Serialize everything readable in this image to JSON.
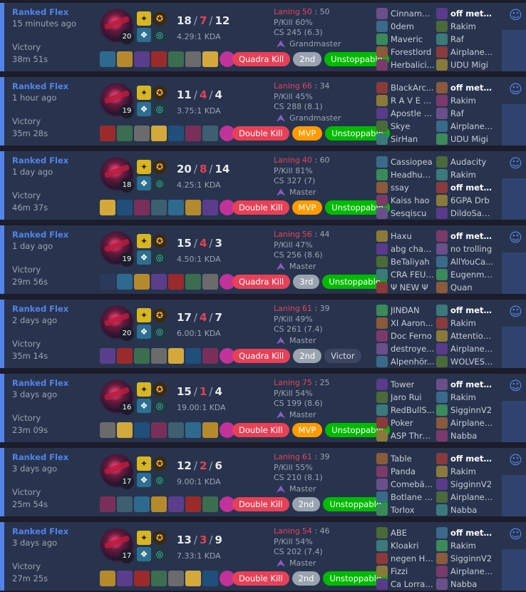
{
  "colors": {
    "accent": "#5383e8",
    "loss": "#e84057",
    "mvp": "#ff9b00",
    "green": "#00bb00"
  },
  "icons": {
    "champion": "champion-portrait",
    "spell1": "flash-icon",
    "spell2": "ghost-icon",
    "rune": "keystone-rune-icon",
    "detail": "ai-score-icon",
    "expand": "chevron-down-icon"
  },
  "matches": [
    {
      "queue": "Ranked Flex",
      "ago": "15 minutes ago",
      "result": "Victory",
      "length": "38m 51s",
      "level": "20",
      "kills": "18",
      "deaths": "7",
      "assists": "12",
      "ratio": "4.29:1 KDA",
      "laning_label": "Laning",
      "laning": "50",
      "laning_opp": "50",
      "pkill": "P/Kill 60%",
      "cs": "CS 245 (6.3)",
      "rank": "Grandmaster",
      "tags": [
        {
          "text": "Quadra Kill",
          "tone": "red"
        },
        {
          "text": "2nd",
          "tone": "grey"
        },
        {
          "text": "Unstoppable",
          "tone": "green"
        }
      ],
      "team1": [
        "Cinnamor...",
        "0dem",
        "Maveric",
        "Forestlord",
        "Herbalici..."
      ],
      "team2": [
        "off meta ...",
        "Rakim",
        "Raf",
        "Airplane ...",
        "UDU Migi"
      ],
      "team2_me": 0
    },
    {
      "queue": "Ranked Flex",
      "ago": "1 hour ago",
      "result": "Victory",
      "length": "35m 28s",
      "level": "19",
      "kills": "11",
      "deaths": "4",
      "assists": "4",
      "ratio": "3.75:1 KDA",
      "laning_label": "Laning",
      "laning": "66",
      "laning_opp": "34",
      "pkill": "P/Kill 45%",
      "cs": "CS 288 (8.1)",
      "rank": "Grandmaster",
      "tags": [
        {
          "text": "Double Kill",
          "tone": "red"
        },
        {
          "text": "MVP",
          "tone": "gold"
        },
        {
          "text": "Unstoppable",
          "tone": "green"
        }
      ],
      "team1": [
        "BlackArc...",
        "R A V E L ...",
        "Apostle o...",
        "Skye",
        "SirHan"
      ],
      "team2": [
        "off meta ...",
        "Rakim",
        "Raf",
        "Airplane ...",
        "UDU Migi"
      ],
      "team2_me": 0
    },
    {
      "queue": "Ranked Flex",
      "ago": "1 day ago",
      "result": "Victory",
      "length": "46m 37s",
      "level": "18",
      "kills": "20",
      "deaths": "8",
      "assists": "14",
      "ratio": "4.25:1 KDA",
      "laning_label": "Laning",
      "laning": "40",
      "laning_opp": "60",
      "pkill": "P/Kill 81%",
      "cs": "CS 327 (7)",
      "rank": "Master",
      "tags": [
        {
          "text": "Double Kill",
          "tone": "red"
        },
        {
          "text": "MVP",
          "tone": "gold"
        },
        {
          "text": "Unstoppable",
          "tone": "green"
        }
      ],
      "team1": [
        "Cassiopea",
        "Headhun...",
        "ssay",
        "Kaiss hao",
        "Sesqiscu"
      ],
      "team2": [
        "Audacity",
        "Rakim",
        "off meta ...",
        "6GPA Drb",
        "DildoSau..."
      ],
      "team2_me": 2
    },
    {
      "queue": "Ranked Flex",
      "ago": "1 day ago",
      "result": "Victory",
      "length": "29m 56s",
      "level": "19",
      "kills": "15",
      "deaths": "4",
      "assists": "3",
      "ratio": "4.50:1 KDA",
      "laning_label": "Laning",
      "laning": "56",
      "laning_opp": "44",
      "pkill": "P/Kill 47%",
      "cs": "CS 256 (8.6)",
      "rank": "Master",
      "tags": [
        {
          "text": "Quadra Kill",
          "tone": "red"
        },
        {
          "text": "3rd",
          "tone": "grey"
        },
        {
          "text": "Unstoppable",
          "tone": "green"
        }
      ],
      "team1": [
        "Haxu",
        "abg chaser",
        "BeTaliyah",
        "CRA FEU ...",
        "Ψ NEW Ψ"
      ],
      "team2": [
        "off meta ...",
        "no trolling",
        "AllYouCa...",
        "Eugenms...",
        "Quan"
      ],
      "team2_me": 0
    },
    {
      "queue": "Ranked Flex",
      "ago": "2 days ago",
      "result": "Victory",
      "length": "35m 14s",
      "level": "20",
      "kills": "17",
      "deaths": "4",
      "assists": "7",
      "ratio": "6.00:1 KDA",
      "laning_label": "Laning",
      "laning": "61",
      "laning_opp": "39",
      "pkill": "P/Kill 49%",
      "cs": "CS 261 (7.4)",
      "rank": "Master",
      "tags": [
        {
          "text": "Quadra Kill",
          "tone": "red"
        },
        {
          "text": "2nd",
          "tone": "grey"
        },
        {
          "text": "Victor",
          "tone": "dark"
        }
      ],
      "team1": [
        "JINĐAN",
        "XI Aaron...",
        "Doc Ferno",
        "destroye...",
        "Alpenhör..."
      ],
      "team2": [
        "off meta ...",
        "Rakim",
        "Attention...",
        "Airplane ...",
        "WOLVES ..."
      ],
      "team2_me": 0
    },
    {
      "queue": "Ranked Flex",
      "ago": "3 days ago",
      "result": "Victory",
      "length": "23m 09s",
      "level": "16",
      "kills": "15",
      "deaths": "1",
      "assists": "4",
      "ratio": "19.00:1 KDA",
      "laning_label": "Laning",
      "laning": "75",
      "laning_opp": "25",
      "pkill": "P/Kill 54%",
      "cs": "CS 199 (8.6)",
      "rank": "Master",
      "tags": [
        {
          "text": "Double Kill",
          "tone": "red"
        },
        {
          "text": "MVP",
          "tone": "gold"
        },
        {
          "text": "Unstoppable",
          "tone": "green"
        }
      ],
      "team1": [
        "Tower",
        "Jaro Rui",
        "RedBullS...",
        "Poker",
        "ASP Thre..."
      ],
      "team2": [
        "off meta ...",
        "Rakim",
        "SigginnV2",
        "Airplane ...",
        "Nabba"
      ],
      "team2_me": 0
    },
    {
      "queue": "Ranked Flex",
      "ago": "3 days ago",
      "result": "Victory",
      "length": "25m 54s",
      "level": "17",
      "kills": "12",
      "deaths": "2",
      "assists": "6",
      "ratio": "9.00:1 KDA",
      "laning_label": "Laning",
      "laning": "61",
      "laning_opp": "39",
      "pkill": "P/Kill 55%",
      "cs": "CS 210 (8.1)",
      "rank": "Master",
      "tags": [
        {
          "text": "Double Kill",
          "tone": "red"
        },
        {
          "text": "2nd",
          "tone": "grey"
        },
        {
          "text": "Unstoppable",
          "tone": "green"
        }
      ],
      "team1": [
        "Table",
        "Panda",
        "Comebäc...",
        "Botlane R...",
        "Torlox"
      ],
      "team2": [
        "off meta ...",
        "Rakim",
        "SigginnV2",
        "Airplane ...",
        "Nabba"
      ],
      "team2_me": 0
    },
    {
      "queue": "Ranked Flex",
      "ago": "3 days ago",
      "result": "Victory",
      "length": "27m 25s",
      "level": "17",
      "kills": "13",
      "deaths": "3",
      "assists": "9",
      "ratio": "7.33:1 KDA",
      "laning_label": "Laning",
      "laning": "54",
      "laning_opp": "46",
      "pkill": "P/Kill 54%",
      "cs": "CS 202 (7.4)",
      "rank": "Master",
      "tags": [
        {
          "text": "Double Kill",
          "tone": "red"
        },
        {
          "text": "2nd",
          "tone": "grey"
        },
        {
          "text": "Unstoppable",
          "tone": "green"
        }
      ],
      "team1": [
        "ABE",
        "Kloakri",
        "negen Ha...",
        "Fizzi",
        "Ca Lorrai..."
      ],
      "team2": [
        "off meta ...",
        "Rakim",
        "SigginnV2",
        "Airplane ...",
        "Nabba"
      ],
      "team2_me": 0
    }
  ]
}
